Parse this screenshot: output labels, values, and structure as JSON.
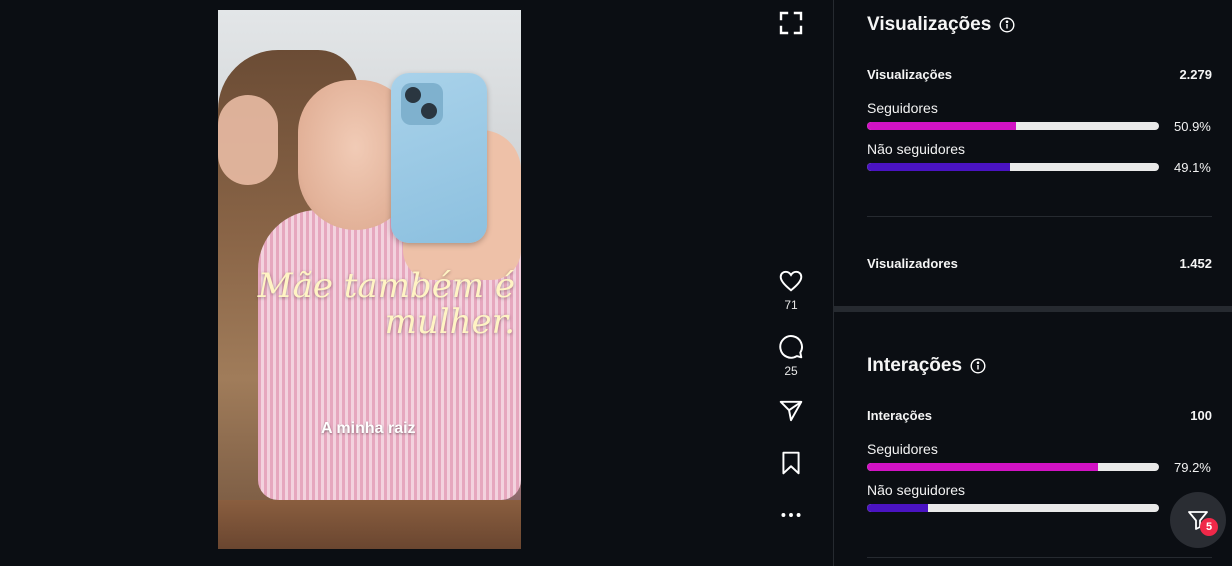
{
  "reel": {
    "overlay_title": "Mãe também é mulher.",
    "overlay_subtitle": "A minha raiz"
  },
  "actions": {
    "like_count": "71",
    "comment_count": "25"
  },
  "views_section": {
    "title": "Visualizações",
    "total_label": "Visualizações",
    "total_value": "2.279",
    "followers_label": "Seguidores",
    "followers_pct": "50.9%",
    "followers_fraction": 0.509,
    "nonfollowers_label": "Não seguidores",
    "nonfollowers_pct": "49.1%",
    "nonfollowers_fraction": 0.491,
    "viewers_label": "Visualizadores",
    "viewers_value": "1.452"
  },
  "interactions_section": {
    "title": "Interações",
    "total_label": "Interações",
    "total_value": "100",
    "followers_label": "Seguidores",
    "followers_pct": "79.2%",
    "followers_fraction": 0.792,
    "nonfollowers_label": "Não seguidores",
    "nonfollowers_fraction": 0.208
  },
  "filter_button": {
    "badge": "5"
  },
  "colors": {
    "followers": "#d212c4",
    "nonfollowers": "#4a13c2",
    "background": "#0b0e13"
  }
}
